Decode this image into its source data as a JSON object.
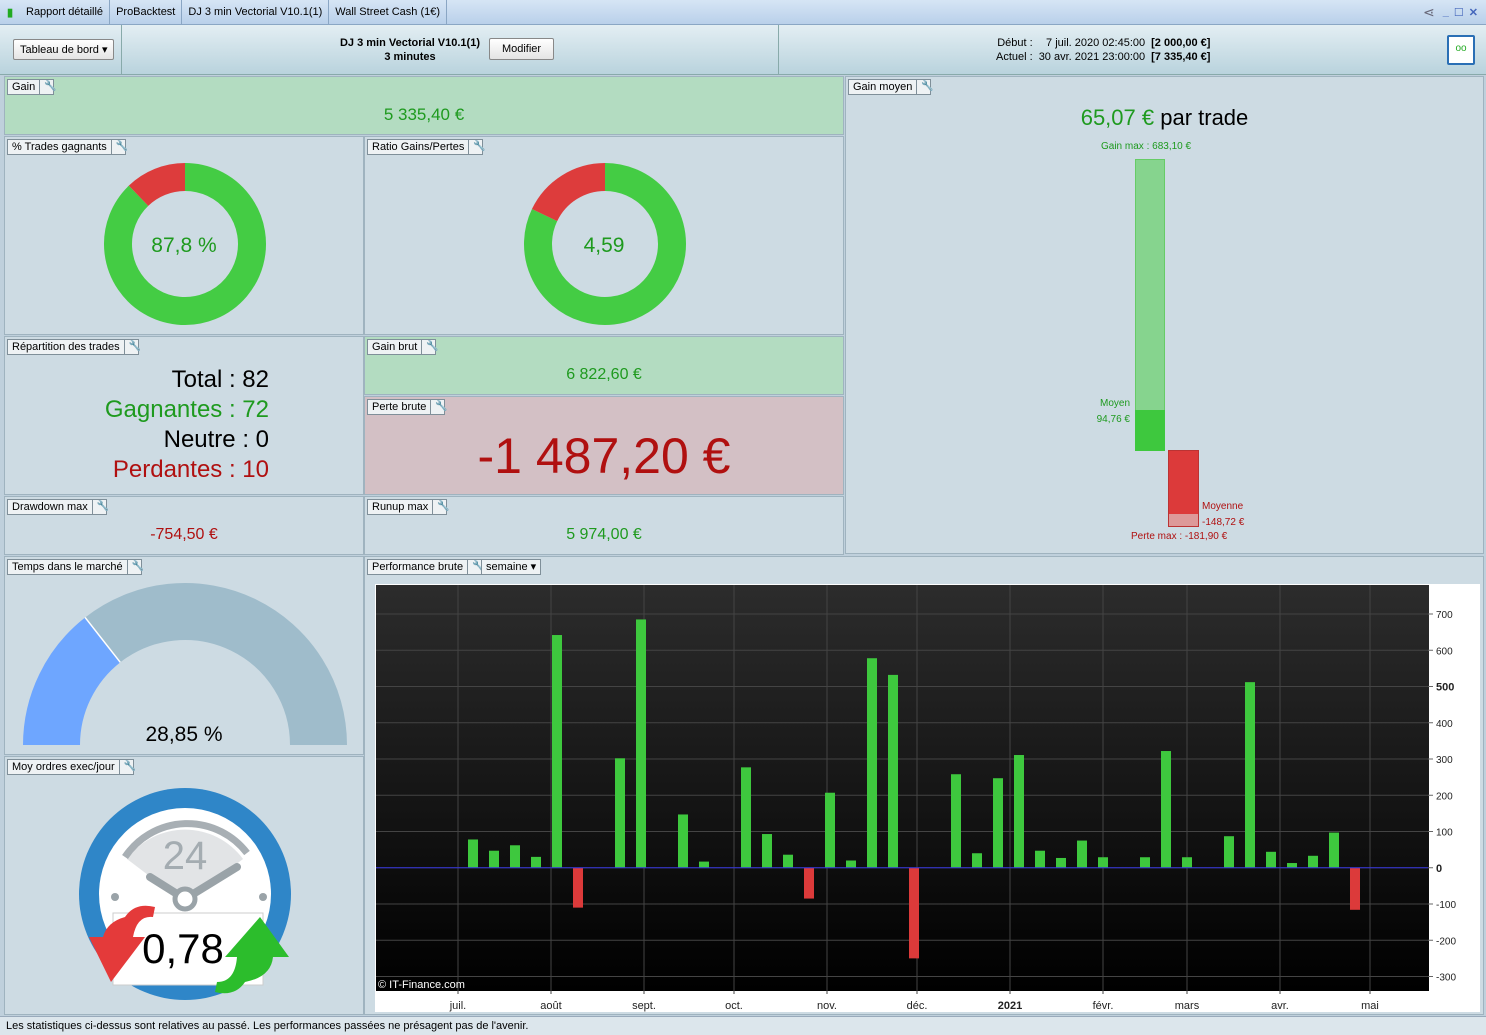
{
  "titlebar": {
    "tabs": [
      "Rapport détaillé",
      "ProBacktest",
      "DJ 3 min Vectorial V10.1(1)",
      "Wall Street Cash (1€)"
    ],
    "icons": [
      "candlestick-icon",
      "share-icon",
      "minimize-icon",
      "maximize-icon",
      "close-icon"
    ]
  },
  "header": {
    "dashboard_select": "Tableau de bord",
    "system_name": "DJ 3 min Vectorial V10.1(1)",
    "timeframe": "3 minutes",
    "modify_label": "Modifier",
    "start_label": "Début :",
    "start_date": "7 juil. 2020 02:45:00",
    "start_capital": "[2 000,00 €]",
    "current_label": "Actuel :",
    "current_date": "30 avr. 2021 23:00:00",
    "current_capital": "[7 335,40 €]"
  },
  "gain": {
    "label": "Gain",
    "value": "5 335,40 €"
  },
  "win_pct": {
    "label": "% Trades gagnants",
    "value": "87,8 %",
    "fraction": 0.878
  },
  "ratio": {
    "label": "Ratio Gains/Pertes",
    "value": "4,59",
    "ratio": 4.59
  },
  "avg_gain": {
    "label": "Gain moyen",
    "value": "65,07 €",
    "suffix": " par trade",
    "max_label": "Gain max : 683,10 €",
    "avg_win_label": "Moyen",
    "avg_win": "94,76 €",
    "avg_loss_label": "Moyenne",
    "avg_loss": "-148,72 €",
    "max_loss_label": "Perte max : -181,90 €"
  },
  "distribution": {
    "label": "Répartition des trades",
    "total": "Total : 82",
    "winners": "Gagnantes : 72",
    "neutral": "Neutre : 0",
    "losers": "Perdantes : 10"
  },
  "gross_gain": {
    "label": "Gain brut",
    "value": "6 822,60 €"
  },
  "gross_loss": {
    "label": "Perte brute",
    "value": "-1 487,20 €"
  },
  "drawdown": {
    "label": "Drawdown max",
    "value": "-754,50 €"
  },
  "runup": {
    "label": "Runup max",
    "value": "5 974,00 €"
  },
  "time_in_market": {
    "label": "Temps dans le marché",
    "value": "28,85 %",
    "fraction": 0.2885
  },
  "orders": {
    "label": "Moy ordres exec/jour",
    "value": "0,78",
    "clock_text": "24"
  },
  "performance": {
    "label": "Performance brute",
    "period": "semaine",
    "watermark": "© IT-Finance.com"
  },
  "chart_data": {
    "type": "bar",
    "ylim": [
      -340,
      780
    ],
    "yticks": [
      700,
      600,
      500,
      400,
      300,
      200,
      100,
      0,
      -100,
      -200,
      -300
    ],
    "xtick_labels": [
      "juil.",
      "août",
      "sept.",
      "oct.",
      "nov.",
      "déc.",
      "2021",
      "févr.",
      "mars",
      "avr.",
      "mai"
    ],
    "xtick_dates": [
      "2020-07-01",
      "2020-08-01",
      "2020-09-01",
      "2020-10-01",
      "2020-11-01",
      "2020-12-01",
      "2021-01-01",
      "2021-02-01",
      "2021-03-01",
      "2021-04-01",
      "2021-05-01"
    ],
    "x_start": "2020-07-01",
    "x_end": "2021-05-18",
    "x": [
      "2020-07-06",
      "2020-07-13",
      "2020-07-20",
      "2020-07-27",
      "2020-08-03",
      "2020-08-10",
      "2020-08-17",
      "2020-08-24",
      "2020-08-31",
      "2020-09-07",
      "2020-09-14",
      "2020-09-21",
      "2020-09-28",
      "2020-10-05",
      "2020-10-12",
      "2020-10-19",
      "2020-10-26",
      "2020-11-02",
      "2020-11-09",
      "2020-11-16",
      "2020-11-23",
      "2020-11-30",
      "2020-12-07",
      "2020-12-14",
      "2020-12-21",
      "2020-12-28",
      "2021-01-04",
      "2021-01-11",
      "2021-01-18",
      "2021-01-25",
      "2021-02-01",
      "2021-02-08",
      "2021-02-15",
      "2021-02-22",
      "2021-03-01",
      "2021-03-08",
      "2021-03-15",
      "2021-03-22",
      "2021-03-29",
      "2021-04-05",
      "2021-04-12",
      "2021-04-19",
      "2021-04-26"
    ],
    "values": [
      78,
      47,
      62,
      30,
      642,
      -110,
      0,
      302,
      685,
      0,
      147,
      17,
      0,
      277,
      93,
      36,
      -85,
      207,
      20,
      578,
      532,
      -250,
      0,
      258,
      40,
      247,
      311,
      47,
      27,
      75,
      29,
      0,
      29,
      322,
      29,
      0,
      87,
      512,
      44,
      13,
      33,
      97,
      -116
    ],
    "colors": {
      "positive": "#3ec83e",
      "negative": "#dc3a3a",
      "zero_line": "#3333dd"
    }
  },
  "footer": {
    "text": "Les statistiques ci-dessus sont relatives au passé. Les performances passées ne présagent pas de l'avenir."
  }
}
